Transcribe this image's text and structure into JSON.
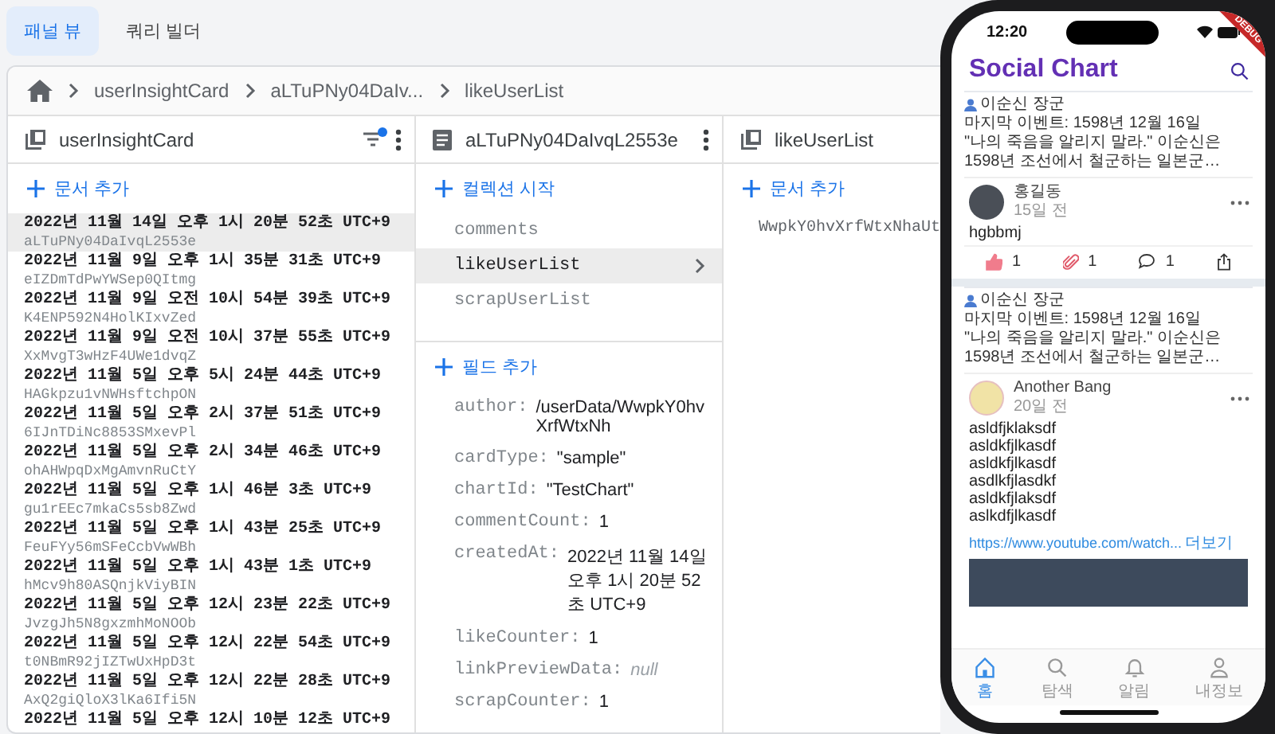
{
  "tabs": [
    {
      "label": "패널 뷰",
      "selected": true
    },
    {
      "label": "쿼리 빌더",
      "selected": false
    }
  ],
  "breadcrumb": [
    "userInsightCard",
    "aLTuPNy04DaIv...",
    "likeUserList"
  ],
  "collection_panel": {
    "title": "userInsightCard",
    "filter_active": true,
    "add_label": "문서 추가",
    "documents": [
      {
        "date": "2022년 11월 14일 오후 1시 20분 52초 UTC+9",
        "id": "aLTuPNy04DaIvqL2553e",
        "selected": true
      },
      {
        "date": "2022년 11월 9일 오후 1시 35분 31초 UTC+9",
        "id": "eIZDmTdPwYWSep0QItmg",
        "selected": false
      },
      {
        "date": "2022년 11월 9일 오전 10시 54분 39초 UTC+9",
        "id": "K4ENP592N4HolKIxvZed",
        "selected": false
      },
      {
        "date": "2022년 11월 9일 오전 10시 37분 55초 UTC+9",
        "id": "XxMvgT3wHzF4UWe1dvqZ",
        "selected": false
      },
      {
        "date": "2022년 11월 5일 오후 5시 24분 44초 UTC+9",
        "id": "HAGkpzu1vNWHsftchpON",
        "selected": false
      },
      {
        "date": "2022년 11월 5일 오후 2시 37분 51초 UTC+9",
        "id": "6IJnTDiNc8853SMxevPl",
        "selected": false
      },
      {
        "date": "2022년 11월 5일 오후 2시 34분 46초 UTC+9",
        "id": "ohAHWpqDxMgAmvnRuCtY",
        "selected": false
      },
      {
        "date": "2022년 11월 5일 오후 1시 46분 3초 UTC+9",
        "id": "gu1rEEc7mkaCs5sb8Zwd",
        "selected": false
      },
      {
        "date": "2022년 11월 5일 오후 1시 43분 25초 UTC+9",
        "id": "FeuFYy56mSFeCcbVwWBh",
        "selected": false
      },
      {
        "date": "2022년 11월 5일 오후 1시 43분 1초 UTC+9",
        "id": "hMcv9h80ASQnjkViyBIN",
        "selected": false
      },
      {
        "date": "2022년 11월 5일 오후 12시 23분 22초 UTC+9",
        "id": "JvzgJh5N8gxzmhMoNOOb",
        "selected": false
      },
      {
        "date": "2022년 11월 5일 오후 12시 22분 54초 UTC+9",
        "id": "t0NBmR92jIZTwUxHpD3t",
        "selected": false
      },
      {
        "date": "2022년 11월 5일 오후 12시 22분 28초 UTC+9",
        "id": "AxQ2giQloX3lKa6Ifi5N",
        "selected": false
      },
      {
        "date": "2022년 11월 5일 오후 12시 10분 12초 UTC+9",
        "selected": false
      }
    ]
  },
  "document_panel": {
    "title": "aLTuPNy04DaIvqL2553e",
    "add_collection_label": "컬렉션 시작",
    "subcollections": [
      {
        "name": "comments",
        "selected": false
      },
      {
        "name": "likeUserList",
        "selected": true
      },
      {
        "name": "scrapUserList",
        "selected": false
      }
    ],
    "add_field_label": "필드 추가",
    "fields": [
      {
        "key": "author:",
        "value": "/userData/WwpkY0hvXrfWtxNh",
        "kind": "reference"
      },
      {
        "key": "cardType:",
        "value": "\"sample\"",
        "kind": "string"
      },
      {
        "key": "chartId:",
        "value": "\"TestChart\"",
        "kind": "string"
      },
      {
        "key": "commentCount:",
        "value": "1",
        "kind": "number"
      },
      {
        "key": "createdAt:",
        "value": "2022년 11월 14일 오후 1시 20분 52초 UTC+9",
        "kind": "timestamp"
      },
      {
        "key": "likeCounter:",
        "value": "1",
        "kind": "number"
      },
      {
        "key": "linkPreviewData:",
        "value": "null",
        "kind": "null"
      },
      {
        "key": "scrapCounter:",
        "value": "1",
        "kind": "number"
      }
    ]
  },
  "subcollection_panel": {
    "title": "likeUserList",
    "add_label": "문서 추가",
    "documents": [
      {
        "id": "WwpkY0hvXrfWtxNhaUt"
      }
    ]
  },
  "phone": {
    "time": "12:20",
    "debug_banner": "DEBUG",
    "app_title": "Social Chart",
    "posts": [
      {
        "event": {
          "person": "이순신 장군",
          "last_event": "마지막 이벤트: 1598년 12월 16일",
          "quote": "\"나의 죽음을 알리지 말라.\" 이순신은 1598년 조선에서 철군하는 일본군…"
        },
        "author": "홍길동",
        "time": "15일 전",
        "body_lines": [
          "hgbbmj"
        ],
        "actions": {
          "liked": true,
          "likes": "1",
          "clipped": true,
          "clips": "1",
          "comments": "1"
        }
      },
      {
        "event": {
          "person": "이순신 장군",
          "last_event": "마지막 이벤트: 1598년 12월 16일",
          "quote": "\"나의 죽음을 알리지 말라.\" 이순신은 1598년 조선에서 철군하는 일본군…"
        },
        "author": "Another Bang",
        "time": "20일 전",
        "body_lines": [
          "asldfjklaksdf",
          "asldkfjlkasdf",
          "asldkfjlkasdf",
          "asdlkfjlasdkf",
          "asldkfjlaksdf",
          "aslkdfjlkasdf"
        ],
        "link": {
          "url": "https://www.youtube.com/watch...",
          "more": "더보기"
        }
      }
    ],
    "nav": [
      {
        "label": "홈",
        "selected": true
      },
      {
        "label": "탐색",
        "selected": false
      },
      {
        "label": "알림",
        "selected": false
      },
      {
        "label": "내정보",
        "selected": false
      }
    ]
  }
}
